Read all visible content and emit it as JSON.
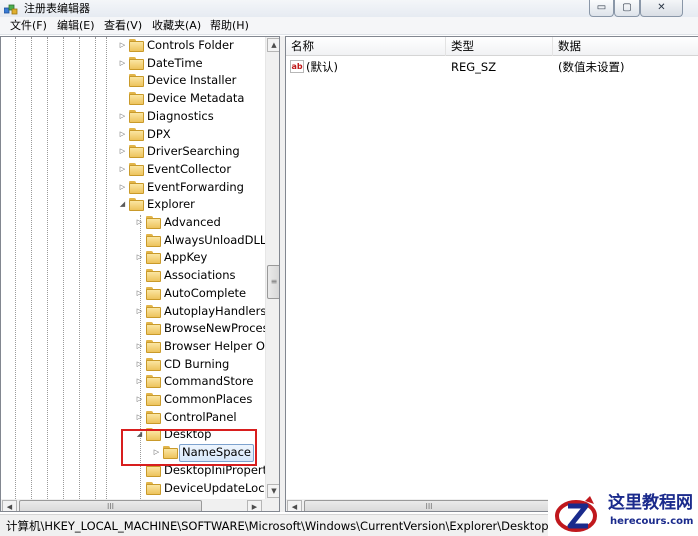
{
  "window": {
    "title": "注册表编辑器",
    "controls": {
      "minimize": "▭",
      "maximize": "▢",
      "close": "✕"
    }
  },
  "menu": [
    {
      "label": "文件(F)"
    },
    {
      "label": "编辑(E)"
    },
    {
      "label": "查看(V)"
    },
    {
      "label": "收藏夹(A)"
    },
    {
      "label": "帮助(H)"
    }
  ],
  "tree": {
    "items": [
      {
        "label": "Controls Folder",
        "expander": "▷"
      },
      {
        "label": "DateTime",
        "expander": "▷"
      },
      {
        "label": "Device Installer",
        "expander": ""
      },
      {
        "label": "Device Metadata",
        "expander": ""
      },
      {
        "label": "Diagnostics",
        "expander": "▷"
      },
      {
        "label": "DPX",
        "expander": "▷"
      },
      {
        "label": "DriverSearching",
        "expander": "▷"
      },
      {
        "label": "EventCollector",
        "expander": "▷"
      },
      {
        "label": "EventForwarding",
        "expander": "▷"
      },
      {
        "label": "Explorer",
        "expander": "◢"
      },
      {
        "label": "Advanced",
        "expander": "▷"
      },
      {
        "label": "AlwaysUnloadDLL",
        "expander": ""
      },
      {
        "label": "AppKey",
        "expander": "▷"
      },
      {
        "label": "Associations",
        "expander": ""
      },
      {
        "label": "AutoComplete",
        "expander": "▷"
      },
      {
        "label": "AutoplayHandlers",
        "expander": "▷"
      },
      {
        "label": "BrowseNewProcess",
        "expander": ""
      },
      {
        "label": "Browser Helper Ob",
        "expander": "▷"
      },
      {
        "label": "CD Burning",
        "expander": "▷"
      },
      {
        "label": "CommandStore",
        "expander": "▷"
      },
      {
        "label": "CommonPlaces",
        "expander": "▷"
      },
      {
        "label": "ControlPanel",
        "expander": "▷"
      },
      {
        "label": "Desktop",
        "expander": "◢"
      },
      {
        "label": "NameSpace",
        "expander": "▷"
      },
      {
        "label": "DesktopIniProperty",
        "expander": ""
      },
      {
        "label": "DeviceUpdateLocati",
        "expander": ""
      }
    ]
  },
  "list": {
    "columns": [
      {
        "label": "名称"
      },
      {
        "label": "类型"
      },
      {
        "label": "数据"
      }
    ],
    "rows": [
      {
        "icon": "ab",
        "name": "(默认)",
        "type": "REG_SZ",
        "data": "(数值未设置)"
      }
    ]
  },
  "scroll": {
    "up": "▲",
    "down": "▼",
    "left": "◀",
    "right": "▶",
    "grip_v": "≡",
    "grip_h": "III"
  },
  "status": {
    "path": "计算机\\HKEY_LOCAL_MACHINE\\SOFTWARE\\Microsoft\\Windows\\CurrentVersion\\Explorer\\Desktop\\NameS"
  },
  "watermark": {
    "title": "这里教程网",
    "url": "herecours.com"
  },
  "colors": {
    "highlight_border": "#d81e1e",
    "folder": "#edc35c",
    "watermark": "#1a2a8c"
  }
}
